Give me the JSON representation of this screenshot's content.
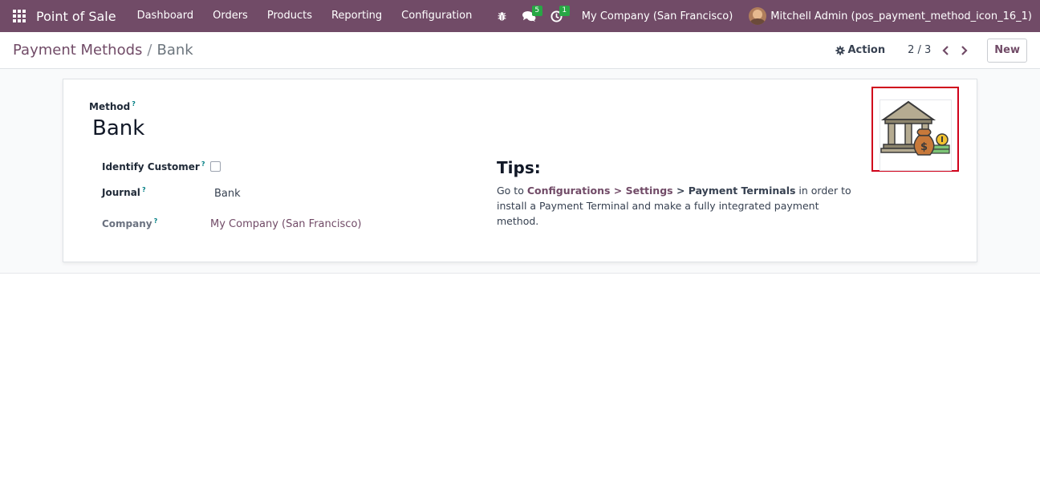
{
  "navbar": {
    "app_name": "Point of Sale",
    "menu": [
      "Dashboard",
      "Orders",
      "Products",
      "Reporting",
      "Configuration"
    ],
    "messages_count": "5",
    "activities_count": "1",
    "company": "My Company (San Francisco)",
    "user": "Mitchell Admin (pos_payment_method_icon_16_1)"
  },
  "breadcrumb": {
    "parent": "Payment Methods",
    "separator": "/",
    "current": "Bank"
  },
  "control": {
    "action_label": "Action",
    "pager": "2 / 3",
    "new_label": "New"
  },
  "form": {
    "method_label": "Method",
    "help_mark": "?",
    "name": "Bank",
    "identify_customer_label": "Identify Customer",
    "identify_customer_checked": false,
    "journal_label": "Journal",
    "journal_value": "Bank",
    "company_label": "Company",
    "company_value": "My Company (San Francisco)",
    "tips_title": "Tips:",
    "tips": {
      "prefix": "Go to ",
      "configurations": "Configurations",
      "arrow1": " > ",
      "settings": "Settings",
      "arrow2": " > ",
      "payment_terminals": "Payment Terminals",
      "suffix": " in order to install a Payment Terminal and make a fully integrated payment method."
    }
  },
  "icons": {
    "apps": "apps-grid-icon",
    "debug": "bug-icon",
    "messages": "chat-icon",
    "activities": "clock-icon",
    "action": "gear-icon",
    "prev": "chevron-left-icon",
    "next": "chevron-right-icon",
    "image": "bank-building-icon"
  },
  "colors": {
    "brand": "#714b67",
    "badge": "#28a745",
    "highlight": "#d0021b",
    "help": "#017e84"
  }
}
